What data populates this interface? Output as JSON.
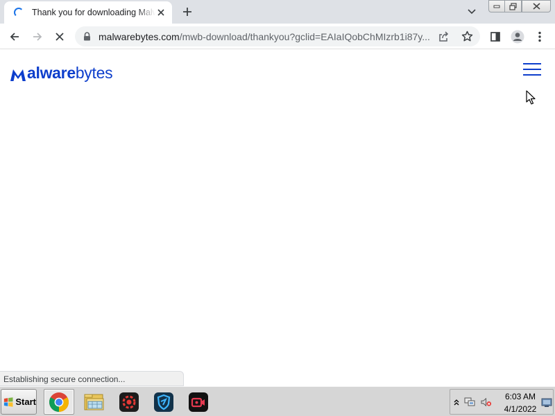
{
  "browser": {
    "tab": {
      "title": "Thank you for downloading Malwarebytes",
      "icon": "loading-spinner-icon"
    },
    "toolbar": {
      "url_host": "malwarebytes.com",
      "url_path": "/mwb-download/thankyou?gclid=EAIaIQobChMIzrb1i87y...",
      "icons": [
        "back-icon",
        "forward-icon",
        "stop-loading-icon",
        "lock-icon",
        "share-icon",
        "bookmark-star-icon",
        "side-panel-icon",
        "profile-icon",
        "more-menu-icon"
      ]
    },
    "window_controls": [
      "minimize-icon",
      "restore-icon",
      "close-icon"
    ],
    "status": "Establishing secure connection..."
  },
  "site": {
    "logo": {
      "m": "M",
      "bold": "alware",
      "regular": "bytes"
    },
    "menu_icon": "hamburger-menu-icon",
    "brand_color": "#0d3ecc"
  },
  "taskbar": {
    "start_label": "Start",
    "apps": [
      "chrome-icon",
      "file-explorer-icon",
      "red-gear-app-icon",
      "vpn-shield-app-icon",
      "screen-recorder-app-icon"
    ],
    "tray_icons": [
      "show-hidden-icons-icon",
      "network-icon",
      "volume-muted-icon"
    ],
    "time": "6:03 AM",
    "date": "4/1/2022"
  }
}
